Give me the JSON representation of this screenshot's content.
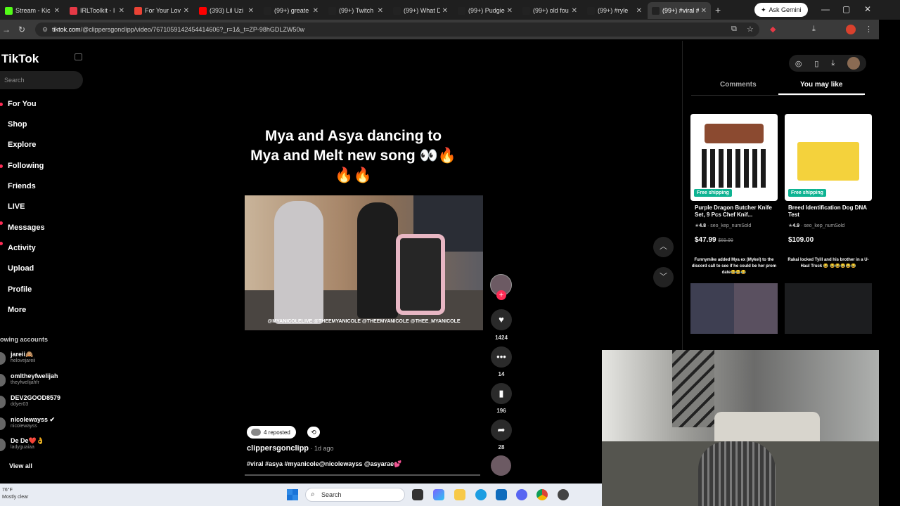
{
  "browser": {
    "tabs": [
      {
        "label": "Stream - Kic",
        "color": "#53fc18"
      },
      {
        "label": "IRLToolkit - I",
        "color": "#e63946"
      },
      {
        "label": "For Your Lov",
        "color": "#ea4335"
      },
      {
        "label": "(393) Lil Uzi",
        "color": "#ff0000"
      },
      {
        "label": "(99+) greate",
        "color": "#222222"
      },
      {
        "label": "(99+) Twitch",
        "color": "#222222"
      },
      {
        "label": "(99+) What D",
        "color": "#222222"
      },
      {
        "label": "(99+) Pudgie",
        "color": "#222222"
      },
      {
        "label": "(99+) old fou",
        "color": "#222222"
      },
      {
        "label": "(99+) #ryle",
        "color": "#222222"
      },
      {
        "label": "(99+) #viral #",
        "color": "#222222"
      }
    ],
    "new_tab": "+",
    "gemini_label": "Ask Gemini",
    "url_host": "tiktok.com",
    "url_path": "/@clippersgonclipp/video/7671059142454414606?_r=1&_t=ZP-98hGDLZW50w"
  },
  "tiktok": {
    "logo": "TikTok",
    "search_placeholder": "Search",
    "nav": [
      "For You",
      "Shop",
      "Explore",
      "Following",
      "Friends",
      "LIVE",
      "Messages",
      "Activity",
      "Upload",
      "Profile",
      "More"
    ],
    "following_header": "owing accounts",
    "accounts": [
      {
        "name": "jareii🙈",
        "user": "helovejareii"
      },
      {
        "name": "omltheyfwelijah",
        "user": "theyfwelijahfr"
      },
      {
        "name": "DEV2GOOD8579",
        "user": "ddyer03"
      },
      {
        "name": "nicolewayss ✔",
        "user": "nicolewayss"
      },
      {
        "name": "De De❤️👌",
        "user": "ladyguaiaa"
      }
    ],
    "view_all": "View all"
  },
  "video": {
    "title_line1": "Mya and Asya dancing to",
    "title_line2": "Mya and Melt new song 👀🔥",
    "title_line3": "🔥🔥",
    "watermark": "@MYANICOLELIVE   @THEEMYANICOLE   @THEEMYANICOLE   @THEE_MYANICOLE",
    "likes": "1424",
    "comments": "14",
    "saves": "196",
    "shares": "28",
    "reposted": "4 reposted",
    "author": "clippersgonclipp",
    "posted": " · 1d ago",
    "hashtags": "#viral #asya #myanicole@nicolewayss @asyarae💕"
  },
  "panel": {
    "tab_comments": "Comments",
    "tab_you_may_like": "You may like",
    "products": [
      {
        "name": "Purple Dragon Butcher Knife Set, 9 Pcs Chef Knif...",
        "rating": "4.8",
        "sold": "seo_kep_numSold",
        "price": "$47.99",
        "old_price": "$69.99",
        "badge": "Free shipping"
      },
      {
        "name": "Breed Identification Dog DNA Test",
        "rating": "4.9",
        "sold": "seo_kep_numSold",
        "price": "$109.00",
        "old_price": "",
        "badge": "Free shipping"
      }
    ],
    "recommended": [
      {
        "caption": "Funnymike added Mya ex (Mykel) to the discord call to see if he could be her prom date😂😂😂"
      },
      {
        "caption": "Rakai locked Tyill and his brother in a U-Haul Truck 😂 😂😂😂😂😂"
      }
    ]
  },
  "taskbar": {
    "temp": "76°F",
    "weather": "Mostly clear",
    "search_label": "Search"
  }
}
